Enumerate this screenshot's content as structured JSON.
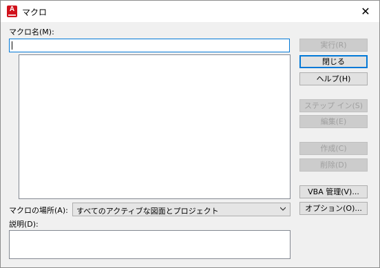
{
  "window": {
    "title": "マクロ",
    "app_icon_letter": "A",
    "close_glyph": "✕"
  },
  "macro_name": {
    "label": "マクロ名(M):",
    "value": ""
  },
  "macro_list": {
    "items": []
  },
  "buttons": {
    "run": "実行(R)",
    "close": "閉じる",
    "help": "ヘルプ(H)",
    "step_into": "ステップ イン(S)",
    "edit": "編集(E)",
    "create": "作成(C)",
    "delete": "削除(D)",
    "vba_manager": "VBA 管理(V)...",
    "options": "オプション(O)..."
  },
  "macros_in": {
    "label": "マクロの場所(A):",
    "selected": "すべてのアクティブな図面とプロジェクト"
  },
  "description": {
    "label": "説明(D):",
    "value": ""
  },
  "colors": {
    "accent": "#0078d7",
    "app_icon": "#d1121c",
    "disabled_text": "#a0a0a0"
  },
  "icons": {
    "app": "autocad-icon",
    "close": "close-icon",
    "dropdown": "chevron-down-icon"
  }
}
